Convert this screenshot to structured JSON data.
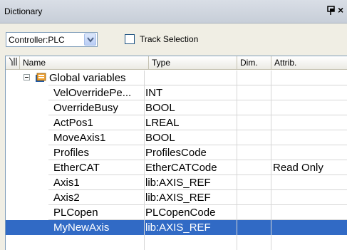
{
  "window": {
    "title": "Dictionary",
    "close_glyph": "×",
    "pin_icon": "pin-icon"
  },
  "toolbar": {
    "controller_value": "Controller:PLC",
    "track_selection_label": "Track Selection",
    "track_selection_checked": false
  },
  "table": {
    "headers": {
      "name": "Name",
      "type": "Type",
      "dim": "Dim.",
      "attrib": "Attrib."
    },
    "group": {
      "label": "Global variables",
      "expanded": true,
      "icon": "global-variables-icon"
    },
    "rows": [
      {
        "name": "VelOverridePe...",
        "type": "INT",
        "dim": "",
        "attrib": ""
      },
      {
        "name": "OverrideBusy",
        "type": "BOOL",
        "dim": "",
        "attrib": ""
      },
      {
        "name": "ActPos1",
        "type": "LREAL",
        "dim": "",
        "attrib": ""
      },
      {
        "name": "MoveAxis1",
        "type": "BOOL",
        "dim": "",
        "attrib": ""
      },
      {
        "name": "Profiles",
        "type": "ProfilesCode",
        "dim": "",
        "attrib": ""
      },
      {
        "name": "EtherCAT",
        "type": "EtherCATCode",
        "dim": "",
        "attrib": "Read Only"
      },
      {
        "name": "Axis1",
        "type": "lib:AXIS_REF",
        "dim": "",
        "attrib": ""
      },
      {
        "name": "Axis2",
        "type": "lib:AXIS_REF",
        "dim": "",
        "attrib": ""
      },
      {
        "name": "PLCopen",
        "type": "PLCopenCode",
        "dim": "",
        "attrib": ""
      },
      {
        "name": "MyNewAxis",
        "type": "lib:AXIS_REF",
        "dim": "",
        "attrib": "",
        "selected": true
      }
    ]
  },
  "colors": {
    "selection": "#316ac5",
    "panel_background": "#f0eee4"
  }
}
